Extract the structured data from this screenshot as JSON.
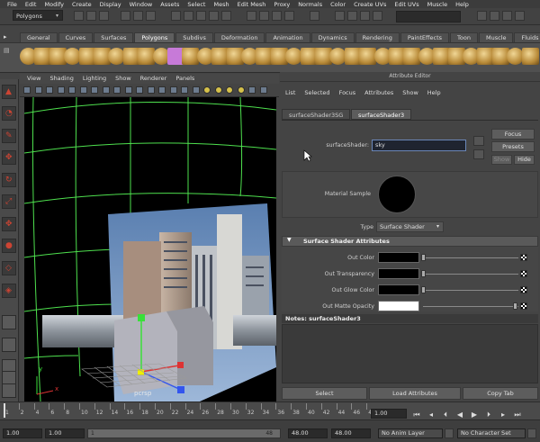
{
  "menubar": [
    "File",
    "Edit",
    "Modify",
    "Create",
    "Display",
    "Window",
    "Assets",
    "Select",
    "Mesh",
    "Edit Mesh",
    "Proxy",
    "Normals",
    "Color",
    "Create UVs",
    "Edit UVs",
    "Muscle",
    "Help"
  ],
  "mode_select": "Polygons",
  "shelf_tabs": [
    {
      "label": "General",
      "active": false
    },
    {
      "label": "Curves",
      "active": false
    },
    {
      "label": "Surfaces",
      "active": false
    },
    {
      "label": "Polygons",
      "active": true
    },
    {
      "label": "Subdivs",
      "active": false
    },
    {
      "label": "Deformation",
      "active": false
    },
    {
      "label": "Animation",
      "active": false
    },
    {
      "label": "Dynamics",
      "active": false
    },
    {
      "label": "Rendering",
      "active": false
    },
    {
      "label": "PaintEffects",
      "active": false
    },
    {
      "label": "Toon",
      "active": false
    },
    {
      "label": "Muscle",
      "active": false
    },
    {
      "label": "Fluids",
      "active": false
    }
  ],
  "panel_menu": [
    "View",
    "Shading",
    "Lighting",
    "Show",
    "Renderer",
    "Panels"
  ],
  "viewport": {
    "camera_label": "pcrsp",
    "axis_y": "y",
    "axis_x": "x"
  },
  "attribute_editor": {
    "title": "Attribute Editor",
    "menu": [
      "List",
      "Selected",
      "Focus",
      "Attributes",
      "Show",
      "Help"
    ],
    "tabs": [
      {
        "label": "surfaceShader3SG",
        "active": false
      },
      {
        "label": "surfaceShader3",
        "active": true
      }
    ],
    "shader_label": "surfaceShader:",
    "shader_value": "sky",
    "focus": "Focus",
    "presets": "Presets",
    "show": "Show",
    "hide": "Hide",
    "material_sample": "Material Sample",
    "type_label": "Type",
    "type_value": "Surface Shader",
    "section_title": "Surface Shader Attributes",
    "attributes": [
      {
        "label": "Out Color",
        "color": "#000000",
        "level": 0.0
      },
      {
        "label": "Out Transparency",
        "color": "#000000",
        "level": 0.0
      },
      {
        "label": "Out Glow Color",
        "color": "#000000",
        "level": 0.0
      },
      {
        "label": "Out Matte Opacity",
        "color": "#ffffff",
        "level": 1.0
      }
    ],
    "notes_label": "Notes:  surfaceShader3",
    "buttons": {
      "select": "Select",
      "load": "Load Attributes",
      "copy": "Copy Tab"
    }
  },
  "timeline": {
    "ticks": [
      "1",
      "2",
      "4",
      "6",
      "8",
      "10",
      "12",
      "14",
      "16",
      "18",
      "20",
      "22",
      "24",
      "26",
      "28",
      "30",
      "32",
      "34",
      "36",
      "38",
      "40",
      "42",
      "44",
      "46",
      "48"
    ],
    "current_frame": "1.00",
    "start_time": "1.00",
    "playback_start": "1.00",
    "range_value": "1",
    "playback_end": "48",
    "end_time": "48.00",
    "max_time": "48.00",
    "anim_layer": "No Anim Layer",
    "character_set": "No Character Set"
  },
  "colors": {
    "grid": "#4ee04e",
    "accent": "#5a6e8c"
  }
}
